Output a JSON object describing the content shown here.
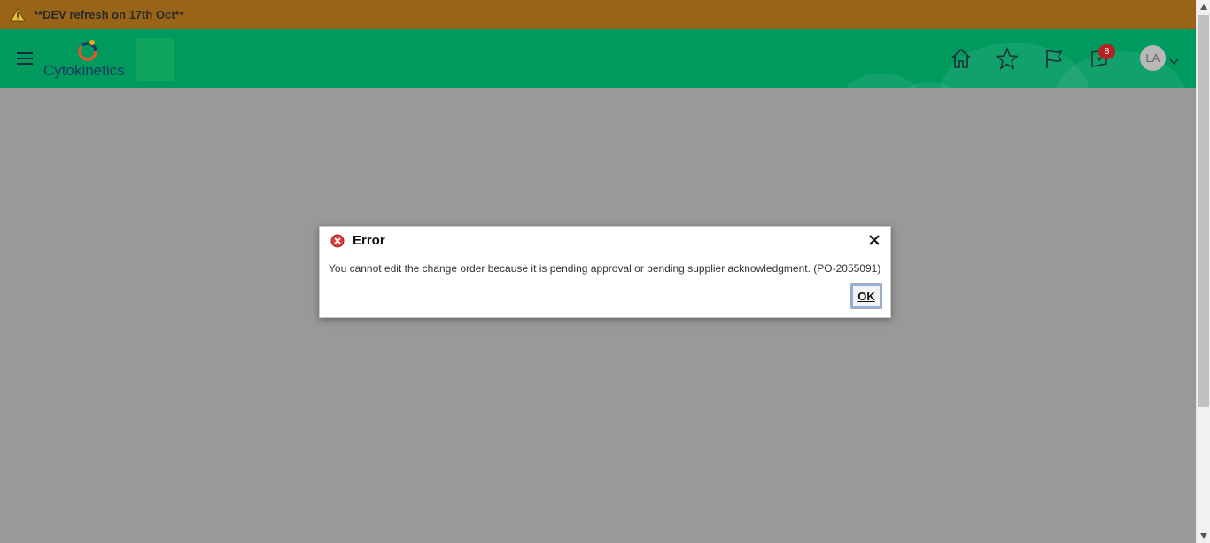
{
  "banner": {
    "text": "**DEV refresh on 17th Oct**",
    "icon": "warning-icon",
    "color": "#9a6418"
  },
  "header": {
    "brand": "Cytokinetics",
    "color": "#009a5f",
    "icons": [
      "menu-icon",
      "home-icon",
      "star-icon",
      "flag-icon",
      "notifications-icon"
    ],
    "notification_count": "8",
    "avatar_initials": "LA"
  },
  "dialog": {
    "title": "Error",
    "icon": "error-icon",
    "message": "You cannot edit the change order because it is pending approval or pending supplier acknowledgment. (PO-2055091)",
    "ok_label": "OK"
  }
}
